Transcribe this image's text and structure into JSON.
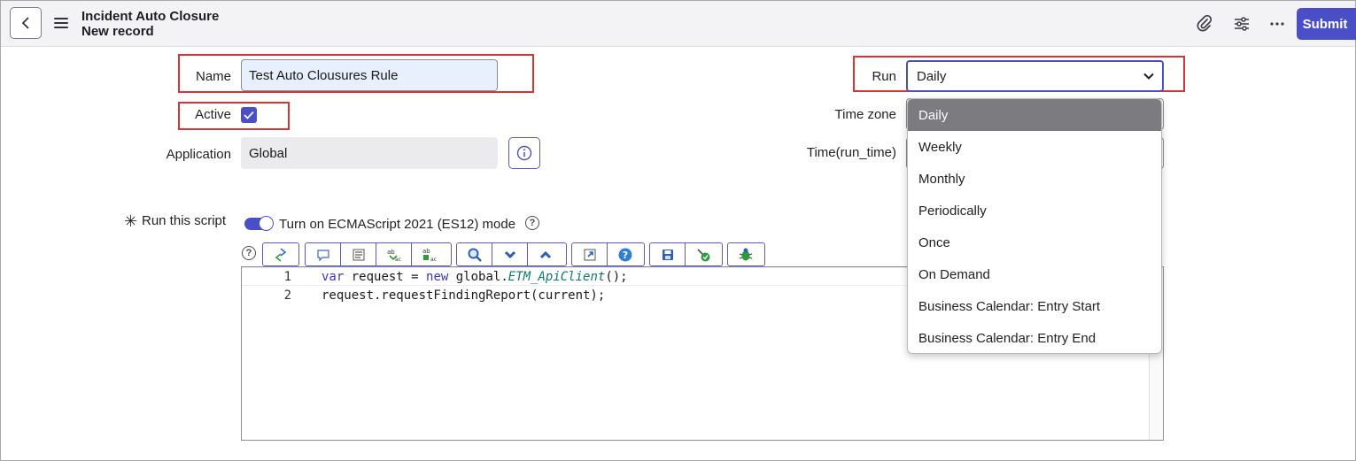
{
  "header": {
    "title": "Incident Auto Closure",
    "subtitle": "New record",
    "submit_label": "Submit"
  },
  "form": {
    "name_label": "Name",
    "name_value": "Test Auto Clousures Rule",
    "active_label": "Active",
    "active_checked": true,
    "application_label": "Application",
    "application_value": "Global",
    "run_label": "Run",
    "run_value": "Daily",
    "timezone_label": "Time zone",
    "runtime_label": "Time(run_time)",
    "script_label": "Run this script",
    "es_mode_label": "Turn on ECMAScript 2021 (ES12) mode"
  },
  "run_options": [
    "Daily",
    "Weekly",
    "Monthly",
    "Periodically",
    "Once",
    "On Demand",
    "Business Calendar: Entry Start",
    "Business Calendar: Entry End"
  ],
  "editor": {
    "line_numbers": [
      "1",
      "2"
    ],
    "line1": {
      "kw1": "var",
      "text1": " request = ",
      "kw2": "new",
      "text2": " global.",
      "fn": "ETM_ApiClient",
      "text3": "();"
    },
    "line2": "request.requestFindingReport(current);"
  },
  "colors": {
    "accent": "#4b4fc7",
    "highlight": "#d83434",
    "selected_option": "#7b7b80"
  }
}
